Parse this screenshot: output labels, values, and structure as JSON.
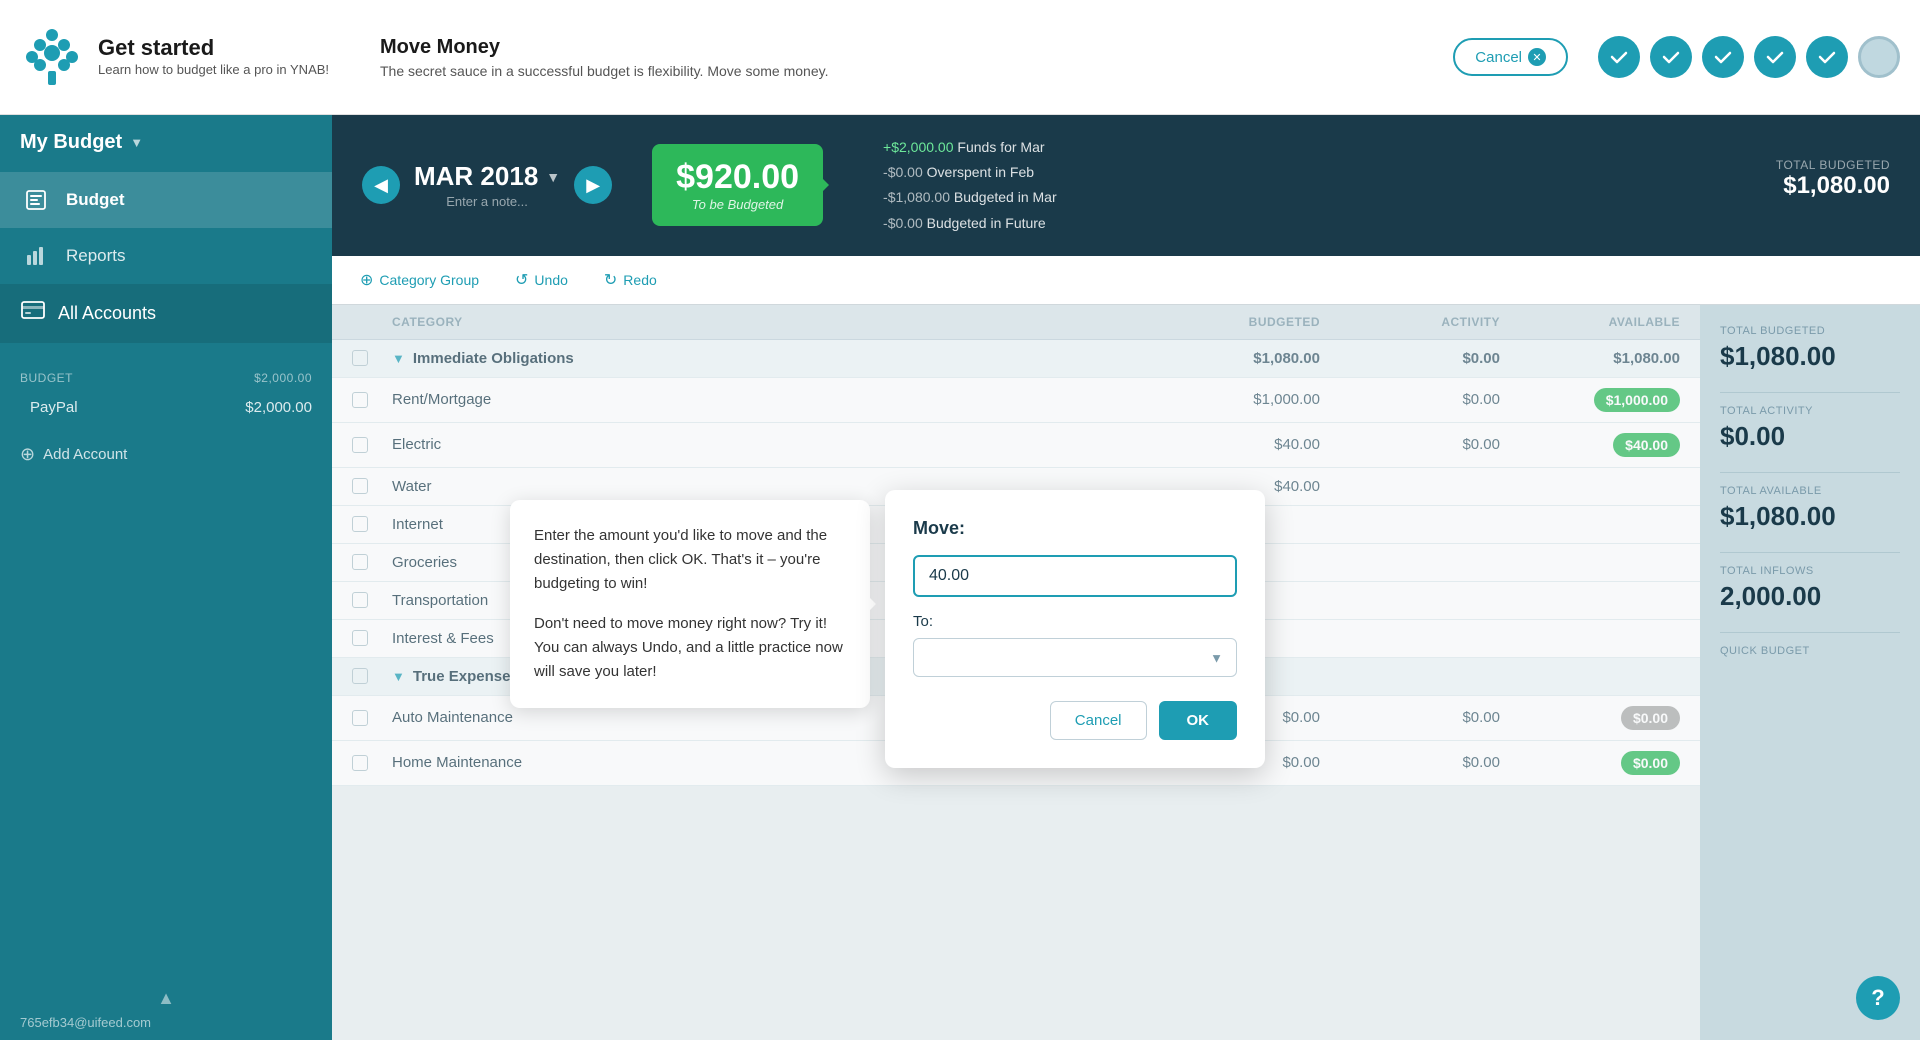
{
  "app": {
    "title": "Get started",
    "subtitle": "Learn how to budget like a pro in YNAB!"
  },
  "banner": {
    "title": "Move Money",
    "description": "The secret sauce in a successful budget is flexibility. Move some money.",
    "cancel_label": "Cancel"
  },
  "steps": [
    {
      "id": 1,
      "done": true
    },
    {
      "id": 2,
      "done": true
    },
    {
      "id": 3,
      "done": true
    },
    {
      "id": 4,
      "done": true
    },
    {
      "id": 5,
      "done": true
    },
    {
      "id": 6,
      "done": false
    }
  ],
  "sidebar": {
    "my_budget_label": "My Budget",
    "nav_items": [
      {
        "label": "Budget",
        "icon": "budget-icon"
      },
      {
        "label": "Reports",
        "icon": "reports-icon"
      },
      {
        "label": "All Accounts",
        "icon": "accounts-icon"
      }
    ],
    "budget_section_label": "BUDGET",
    "accounts": [
      {
        "name": "PayPal",
        "amount": "$2,000.00"
      }
    ],
    "budget_total": "$2,000.00",
    "add_account_label": "Add Account",
    "user_email": "765efb34@uifeed.com"
  },
  "budget_header": {
    "prev_arrow": "◀",
    "next_arrow": "▶",
    "month": "MAR 2018",
    "note_placeholder": "Enter a note...",
    "to_budget_amount": "$920.00",
    "to_budget_label": "To be Budgeted",
    "breakdown": [
      {
        "label": "+$2,000.00",
        "desc": "Funds for Mar",
        "type": "positive"
      },
      {
        "label": "-$0.00",
        "desc": "Overspent in Feb",
        "type": "zero"
      },
      {
        "label": "-$1,080.00",
        "desc": "Budgeted in Mar",
        "type": "negative"
      },
      {
        "label": "-$0.00",
        "desc": "Budgeted in Future",
        "type": "negative"
      }
    ]
  },
  "toolbar": {
    "add_category_label": "Category Group",
    "undo_label": "Undo",
    "redo_label": "Redo"
  },
  "table": {
    "headers": [
      "",
      "CATEGORY",
      "BUDGETED",
      "ACTIVITY",
      "AVAILABLE"
    ],
    "groups": [
      {
        "name": "Immediate Obligations",
        "budgeted": "$1,080.00",
        "activity": "$0.00",
        "available": "$1,080.00",
        "rows": [
          {
            "name": "Rent/Mortgage",
            "budgeted": "$1,000.00",
            "activity": "$0.00",
            "available": "$1,000.00",
            "available_style": "green"
          },
          {
            "name": "Electric",
            "budgeted": "$40.00",
            "activity": "$0.00",
            "available": "$40.00",
            "available_style": "green"
          },
          {
            "name": "Water",
            "budgeted": "$40.00",
            "activity": "",
            "available": "",
            "available_style": "none"
          },
          {
            "name": "Internet",
            "budgeted": "",
            "activity": "",
            "available": "",
            "available_style": "none"
          },
          {
            "name": "Groceries",
            "budgeted": "",
            "activity": "",
            "available": "",
            "available_style": "none"
          },
          {
            "name": "Transportation",
            "budgeted": "",
            "activity": "",
            "available": "",
            "available_style": "none"
          },
          {
            "name": "Interest & Fees",
            "budgeted": "",
            "activity": "",
            "available": "",
            "available_style": "none"
          }
        ]
      },
      {
        "name": "True Expenses",
        "budgeted": "",
        "activity": "",
        "available": "",
        "rows": [
          {
            "name": "Auto Maintenance",
            "budgeted": "$0.00",
            "activity": "$0.00",
            "available": "$0.00",
            "available_style": "none"
          },
          {
            "name": "Home Maintenance",
            "budgeted": "$0.00",
            "activity": "$0.00",
            "available": "$0.00",
            "available_style": "green"
          }
        ]
      }
    ]
  },
  "right_stats": {
    "total_budgeted_label": "TOTAL BUDGETED",
    "total_budgeted_value": "$1,080.00",
    "total_activity_label": "TOTAL ACTIVITY",
    "total_activity_value": "$0.00",
    "total_available_label": "TOTAL AVAILABLE",
    "total_available_value": "$1,080.00",
    "total_inflows_label": "TOTAL INFLOWS",
    "total_inflows_value": "2,000.00",
    "quick_budget_label": "QUICK BUDGET"
  },
  "hint": {
    "text1": "Enter the amount you'd like to move and the destination, then click OK. That's it – you're budgeting to win!",
    "text2": "Don't need to move money right now? Try it! You can always Undo, and a little practice now will save you later!"
  },
  "move_modal": {
    "title": "Move:",
    "amount_value": "40.00",
    "to_label": "To:",
    "cancel_label": "Cancel",
    "ok_label": "OK"
  }
}
